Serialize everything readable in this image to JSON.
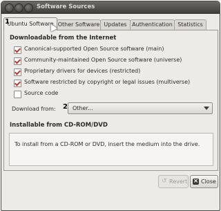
{
  "window": {
    "title": "Software Sources"
  },
  "tabs": [
    {
      "label": "Ubuntu Software"
    },
    {
      "label": "Other Software"
    },
    {
      "label": "Updates"
    },
    {
      "label": "Authentication"
    },
    {
      "label": "Statistics"
    }
  ],
  "markers": {
    "one": "1",
    "two": "2"
  },
  "internet": {
    "heading": "Downloadable from the Internet",
    "options": [
      {
        "label": "Canonical-supported Open Source software (main)",
        "checked": true
      },
      {
        "label": "Community-maintained Open Source software (universe)",
        "checked": true
      },
      {
        "label": "Proprietary drivers for devices (restricted)",
        "checked": true
      },
      {
        "label": "Software restricted by copyright or legal issues (multiverse)",
        "checked": true
      },
      {
        "label": "Source code",
        "checked": false
      }
    ],
    "download_from_label": "Download from:",
    "download_from_value": "Other..."
  },
  "cdrom": {
    "heading": "Installable from CD-ROM/DVD",
    "message": "To install from a CD-ROM or DVD, insert the medium into the drive."
  },
  "buttons": {
    "revert": "Revert",
    "close": "Close"
  },
  "icons": {
    "revert": "revert-icon",
    "close": "close-icon",
    "dropdown": "chevron-down-icon"
  },
  "colors": {
    "check": "#c0392b",
    "titlebar": "#4b4a46"
  }
}
